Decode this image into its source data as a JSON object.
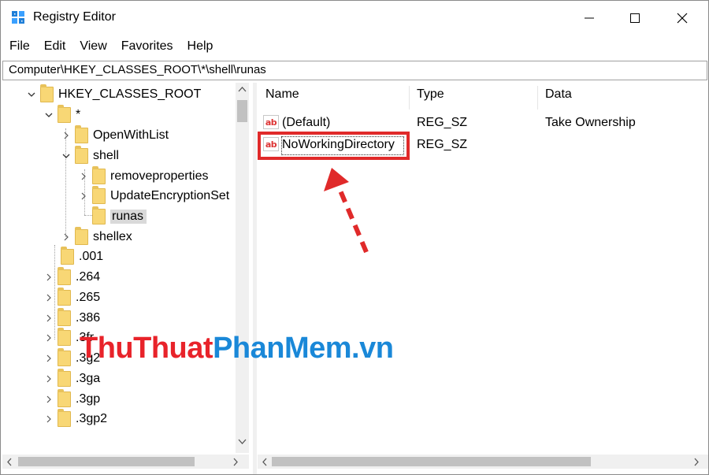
{
  "window": {
    "title": "Registry Editor"
  },
  "menu": [
    "File",
    "Edit",
    "View",
    "Favorites",
    "Help"
  ],
  "address": "Computer\\HKEY_CLASSES_ROOT\\*\\shell\\runas",
  "tree": {
    "items": [
      {
        "label": "HKEY_CLASSES_ROOT",
        "expanded": true
      },
      {
        "label": "*",
        "expanded": true
      },
      {
        "label": "OpenWithList",
        "expanded": false
      },
      {
        "label": "shell",
        "expanded": true
      },
      {
        "label": "removeproperties",
        "expanded": false
      },
      {
        "label": "UpdateEncryptionSet",
        "expanded": false
      },
      {
        "label": "runas",
        "selected": true
      },
      {
        "label": "shellex",
        "expanded": false
      },
      {
        "label": ".001"
      },
      {
        "label": ".264"
      },
      {
        "label": ".265"
      },
      {
        "label": ".386"
      },
      {
        "label": ".3fr"
      },
      {
        "label": ".3g2"
      },
      {
        "label": ".3ga"
      },
      {
        "label": ".3gp"
      },
      {
        "label": ".3gp2"
      }
    ]
  },
  "list": {
    "columns": [
      "Name",
      "Type",
      "Data"
    ],
    "rows": [
      {
        "name": "(Default)",
        "type": "REG_SZ",
        "data": "Take Ownership"
      },
      {
        "name": "NoWorkingDirectory",
        "type": "REG_SZ",
        "data": ""
      }
    ],
    "value_icon": "ab"
  },
  "watermark": {
    "part1": "ThuThuat",
    "part2": "PhanMem",
    "part3": ".vn"
  },
  "colors": {
    "highlight": "#e02a2a",
    "folder": "#f8d775",
    "watermark_red": "#e8232a",
    "watermark_blue": "#1a88d8"
  }
}
